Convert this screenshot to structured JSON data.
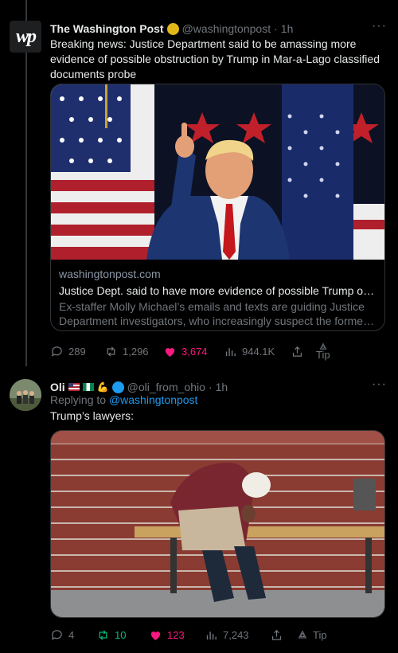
{
  "tweet1": {
    "author": {
      "name": "The Washington Post",
      "handle": "@washingtonpost",
      "time": "1h"
    },
    "text": "Breaking news: Justice Department said to be amassing more evidence of possible obstruction by Trump in Mar-a-Lago classified documents probe",
    "card": {
      "domain": "washingtonpost.com",
      "title": "Justice Dept. said to have more evidence of possible Trump obs...",
      "description": "Ex-staffer Molly Michael’s emails and texts are guiding Justice Department investigators, who increasingly suspect the former ..."
    },
    "stats": {
      "replies": "289",
      "reposts": "1,296",
      "likes": "3,674",
      "views": "944.1K",
      "tip_label": "Tip"
    }
  },
  "tweet2": {
    "author": {
      "name": "Oli",
      "handle": "@oli_from_ohio",
      "time": "1h"
    },
    "reply_prefix": "Replying to",
    "reply_handle": "@washingtonpost",
    "text": "Trump’s lawyers:",
    "stats": {
      "replies": "4",
      "reposts": "10",
      "likes": "123",
      "views": "7,243",
      "tip_label": "Tip"
    }
  },
  "colors": {
    "bg": "#000000",
    "text": "#e7e9ea",
    "muted": "#71767b",
    "accent": "#1d9bf0",
    "like": "#f91880",
    "repost": "#00ba7c"
  }
}
